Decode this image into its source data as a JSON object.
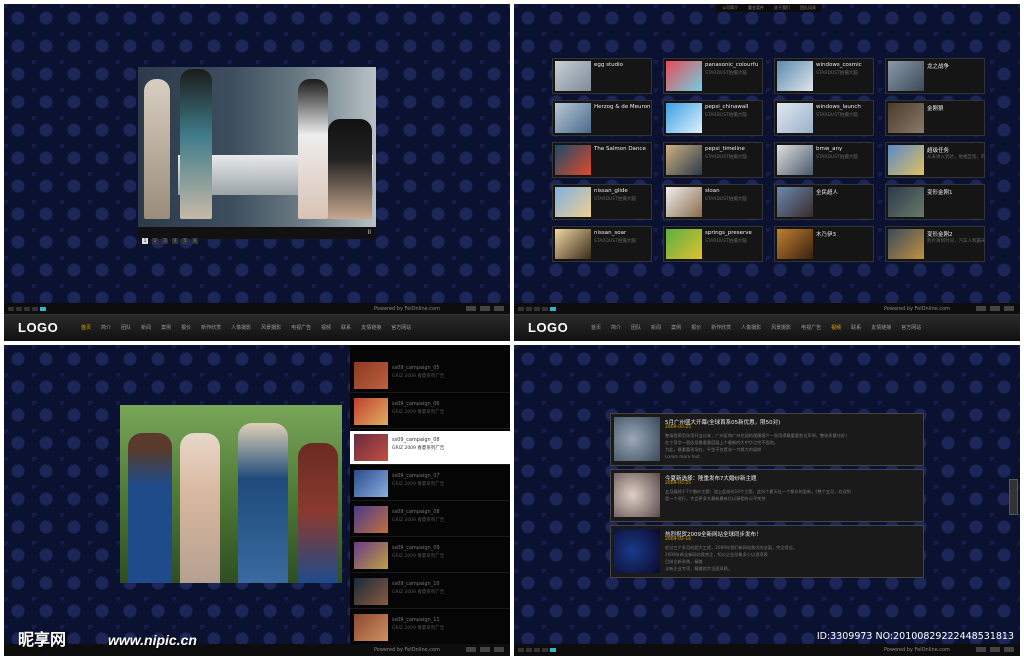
{
  "logo": "LOGO",
  "powered": "Powered by FelOnline.com",
  "nav_items": [
    "首页",
    "简介",
    "团队",
    "新闻",
    "案例",
    "报价",
    "新作欣赏",
    "人像摄影",
    "风景摄影",
    "电视广告",
    "视频",
    "联系",
    "友情链接",
    "官方网站"
  ],
  "panel1": {
    "nav_active": 0,
    "slide_nums": [
      "1",
      "2",
      "3",
      "4",
      "5",
      "6"
    ],
    "pause": "II"
  },
  "panel2": {
    "nav_active": 10,
    "top_menu": [
      "公司简介",
      "重金案件",
      "关于我们",
      "团队风采"
    ],
    "tiles": [
      {
        "title": "egg studio",
        "sub": ""
      },
      {
        "title": "panasonic_colourfu",
        "sub": "STARDUST拍摄大脑"
      },
      {
        "title": "windows_cosmic",
        "sub": "STARDUST拍摄大脑"
      },
      {
        "title": "龙之战争",
        "sub": ""
      },
      {
        "title": "Herzog & de Meuron",
        "sub": ""
      },
      {
        "title": "pepsi_chinawall",
        "sub": "STARDUST拍摄大脑"
      },
      {
        "title": "windows_launch",
        "sub": "STARDUST拍摄大脑"
      },
      {
        "title": "金刚狼",
        "sub": ""
      },
      {
        "title": "The Salmon Dance",
        "sub": ""
      },
      {
        "title": "pepsi_timeline",
        "sub": "STARDUST拍摄大脑"
      },
      {
        "title": "bmw_any",
        "sub": "STARDUST拍摄大脑"
      },
      {
        "title": "超级任务",
        "sub": "从未讲入到达，他相互指，的打种所有士的到某技事，是她近我行什么找"
      },
      {
        "title": "nissan_glide",
        "sub": "STARDUST拍摄大脑"
      },
      {
        "title": "sloan",
        "sub": "STARDUST拍摄大脑"
      },
      {
        "title": "全民超人",
        "sub": ""
      },
      {
        "title": "变形金刚1",
        "sub": ""
      },
      {
        "title": "nissan_soar",
        "sub": "STARDUST拍摄大脑"
      },
      {
        "title": "springs_preserve",
        "sub": "STARDUST拍摄大脑"
      },
      {
        "title": "木乃伊3",
        "sub": ""
      },
      {
        "title": "变形金刚2",
        "sub": "影片讲到时间，汽车人和霸天虎之争战斗，BMW 大黄蜂汽车在的联络结构，继续重结战争"
      }
    ]
  },
  "panel3": {
    "items": [
      {
        "name": "ss09_campaign_05",
        "desc": "GRIZ 2009 春夏系列广告"
      },
      {
        "name": "ss09_campaign_06",
        "desc": "GRIZ 2009 春夏系列广告"
      },
      {
        "name": "ss09_campaign_08",
        "desc": "GRIZ 2009 春夏系列广告"
      },
      {
        "name": "ss09_campaign_07",
        "desc": "GRIZ 2009 春夏系列广告"
      },
      {
        "name": "ss09_campaign_08",
        "desc": "GRIZ 2009 春夏系列广告"
      },
      {
        "name": "ss09_campaign_09",
        "desc": "GRIZ 2009 春夏系列广告"
      },
      {
        "name": "ss09_campaign_10",
        "desc": "GRIZ 2009 春夏系列广告"
      },
      {
        "name": "ss09_campaign_11",
        "desc": "GRIZ 2009 春夏系列广告"
      }
    ],
    "selected": 2
  },
  "panel4": {
    "news": [
      {
        "title": "5月广州盛大开幕(全球首系05新优惠，限50对)",
        "date": "2009-05-25",
        "lines": [
          "整场我荣用年用开业以来，广州区和广州花园的规模客户一直用得最重要各位声明，整体质量作好！",
          "在个用字一直妙用最重量度展上个最新的大中华点完不面地。",
          "为此，最重要现场在，平型不仅是非一大概大的展期",
          "Lorem more text"
        ]
      },
      {
        "title": "今夏新选择：隆重发布7大婚纱新主题",
        "date": "2009-05-25",
        "lines": [
          "五月展经于7个婚纱主题：加上此前的10个主题，此份个夏天社一个都非的面新，《整个五月，欢迎到",
          "是一个进行，大会更多大最新最有位以接相有公平关关"
        ]
      },
      {
        "title": "热烈祝贺2009全新网站全球同步发布！",
        "date": "2009-02-16",
        "lines": [
          "经过三个多月的超大工程，2009年我们新网站和大的全面，完全保全。",
          "2009年新全新网站我关注，知公企业形象多少以进项表",
          "目前全新系统，精美",
          "全新企业专项，精美的大全面风格。"
        ]
      }
    ]
  },
  "watermark": {
    "site": "昵享网",
    "url": "www.nipic.cn",
    "id": "ID:3309973 NO:20100829222448531813"
  }
}
